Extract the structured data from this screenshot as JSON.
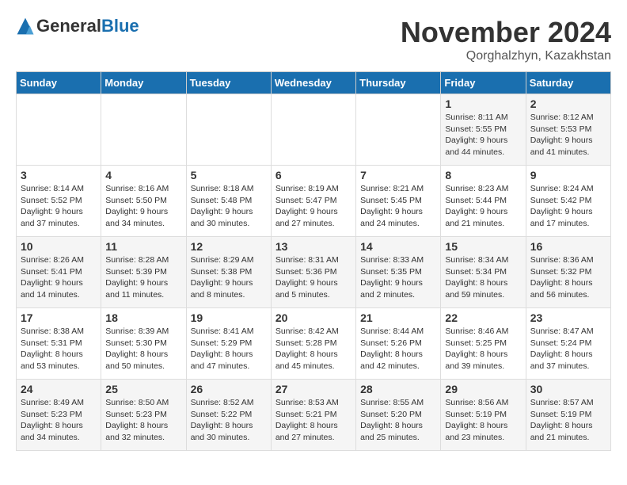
{
  "logo": {
    "general": "General",
    "blue": "Blue"
  },
  "header": {
    "month_title": "November 2024",
    "subtitle": "Qorghalzhyn, Kazakhstan"
  },
  "weekdays": [
    "Sunday",
    "Monday",
    "Tuesday",
    "Wednesday",
    "Thursday",
    "Friday",
    "Saturday"
  ],
  "weeks": [
    [
      {
        "day": "",
        "sunrise": "",
        "sunset": "",
        "daylight": ""
      },
      {
        "day": "",
        "sunrise": "",
        "sunset": "",
        "daylight": ""
      },
      {
        "day": "",
        "sunrise": "",
        "sunset": "",
        "daylight": ""
      },
      {
        "day": "",
        "sunrise": "",
        "sunset": "",
        "daylight": ""
      },
      {
        "day": "",
        "sunrise": "",
        "sunset": "",
        "daylight": ""
      },
      {
        "day": "1",
        "sunrise": "Sunrise: 8:11 AM",
        "sunset": "Sunset: 5:55 PM",
        "daylight": "Daylight: 9 hours and 44 minutes."
      },
      {
        "day": "2",
        "sunrise": "Sunrise: 8:12 AM",
        "sunset": "Sunset: 5:53 PM",
        "daylight": "Daylight: 9 hours and 41 minutes."
      }
    ],
    [
      {
        "day": "3",
        "sunrise": "Sunrise: 8:14 AM",
        "sunset": "Sunset: 5:52 PM",
        "daylight": "Daylight: 9 hours and 37 minutes."
      },
      {
        "day": "4",
        "sunrise": "Sunrise: 8:16 AM",
        "sunset": "Sunset: 5:50 PM",
        "daylight": "Daylight: 9 hours and 34 minutes."
      },
      {
        "day": "5",
        "sunrise": "Sunrise: 8:18 AM",
        "sunset": "Sunset: 5:48 PM",
        "daylight": "Daylight: 9 hours and 30 minutes."
      },
      {
        "day": "6",
        "sunrise": "Sunrise: 8:19 AM",
        "sunset": "Sunset: 5:47 PM",
        "daylight": "Daylight: 9 hours and 27 minutes."
      },
      {
        "day": "7",
        "sunrise": "Sunrise: 8:21 AM",
        "sunset": "Sunset: 5:45 PM",
        "daylight": "Daylight: 9 hours and 24 minutes."
      },
      {
        "day": "8",
        "sunrise": "Sunrise: 8:23 AM",
        "sunset": "Sunset: 5:44 PM",
        "daylight": "Daylight: 9 hours and 21 minutes."
      },
      {
        "day": "9",
        "sunrise": "Sunrise: 8:24 AM",
        "sunset": "Sunset: 5:42 PM",
        "daylight": "Daylight: 9 hours and 17 minutes."
      }
    ],
    [
      {
        "day": "10",
        "sunrise": "Sunrise: 8:26 AM",
        "sunset": "Sunset: 5:41 PM",
        "daylight": "Daylight: 9 hours and 14 minutes."
      },
      {
        "day": "11",
        "sunrise": "Sunrise: 8:28 AM",
        "sunset": "Sunset: 5:39 PM",
        "daylight": "Daylight: 9 hours and 11 minutes."
      },
      {
        "day": "12",
        "sunrise": "Sunrise: 8:29 AM",
        "sunset": "Sunset: 5:38 PM",
        "daylight": "Daylight: 9 hours and 8 minutes."
      },
      {
        "day": "13",
        "sunrise": "Sunrise: 8:31 AM",
        "sunset": "Sunset: 5:36 PM",
        "daylight": "Daylight: 9 hours and 5 minutes."
      },
      {
        "day": "14",
        "sunrise": "Sunrise: 8:33 AM",
        "sunset": "Sunset: 5:35 PM",
        "daylight": "Daylight: 9 hours and 2 minutes."
      },
      {
        "day": "15",
        "sunrise": "Sunrise: 8:34 AM",
        "sunset": "Sunset: 5:34 PM",
        "daylight": "Daylight: 8 hours and 59 minutes."
      },
      {
        "day": "16",
        "sunrise": "Sunrise: 8:36 AM",
        "sunset": "Sunset: 5:32 PM",
        "daylight": "Daylight: 8 hours and 56 minutes."
      }
    ],
    [
      {
        "day": "17",
        "sunrise": "Sunrise: 8:38 AM",
        "sunset": "Sunset: 5:31 PM",
        "daylight": "Daylight: 8 hours and 53 minutes."
      },
      {
        "day": "18",
        "sunrise": "Sunrise: 8:39 AM",
        "sunset": "Sunset: 5:30 PM",
        "daylight": "Daylight: 8 hours and 50 minutes."
      },
      {
        "day": "19",
        "sunrise": "Sunrise: 8:41 AM",
        "sunset": "Sunset: 5:29 PM",
        "daylight": "Daylight: 8 hours and 47 minutes."
      },
      {
        "day": "20",
        "sunrise": "Sunrise: 8:42 AM",
        "sunset": "Sunset: 5:28 PM",
        "daylight": "Daylight: 8 hours and 45 minutes."
      },
      {
        "day": "21",
        "sunrise": "Sunrise: 8:44 AM",
        "sunset": "Sunset: 5:26 PM",
        "daylight": "Daylight: 8 hours and 42 minutes."
      },
      {
        "day": "22",
        "sunrise": "Sunrise: 8:46 AM",
        "sunset": "Sunset: 5:25 PM",
        "daylight": "Daylight: 8 hours and 39 minutes."
      },
      {
        "day": "23",
        "sunrise": "Sunrise: 8:47 AM",
        "sunset": "Sunset: 5:24 PM",
        "daylight": "Daylight: 8 hours and 37 minutes."
      }
    ],
    [
      {
        "day": "24",
        "sunrise": "Sunrise: 8:49 AM",
        "sunset": "Sunset: 5:23 PM",
        "daylight": "Daylight: 8 hours and 34 minutes."
      },
      {
        "day": "25",
        "sunrise": "Sunrise: 8:50 AM",
        "sunset": "Sunset: 5:23 PM",
        "daylight": "Daylight: 8 hours and 32 minutes."
      },
      {
        "day": "26",
        "sunrise": "Sunrise: 8:52 AM",
        "sunset": "Sunset: 5:22 PM",
        "daylight": "Daylight: 8 hours and 30 minutes."
      },
      {
        "day": "27",
        "sunrise": "Sunrise: 8:53 AM",
        "sunset": "Sunset: 5:21 PM",
        "daylight": "Daylight: 8 hours and 27 minutes."
      },
      {
        "day": "28",
        "sunrise": "Sunrise: 8:55 AM",
        "sunset": "Sunset: 5:20 PM",
        "daylight": "Daylight: 8 hours and 25 minutes."
      },
      {
        "day": "29",
        "sunrise": "Sunrise: 8:56 AM",
        "sunset": "Sunset: 5:19 PM",
        "daylight": "Daylight: 8 hours and 23 minutes."
      },
      {
        "day": "30",
        "sunrise": "Sunrise: 8:57 AM",
        "sunset": "Sunset: 5:19 PM",
        "daylight": "Daylight: 8 hours and 21 minutes."
      }
    ]
  ]
}
